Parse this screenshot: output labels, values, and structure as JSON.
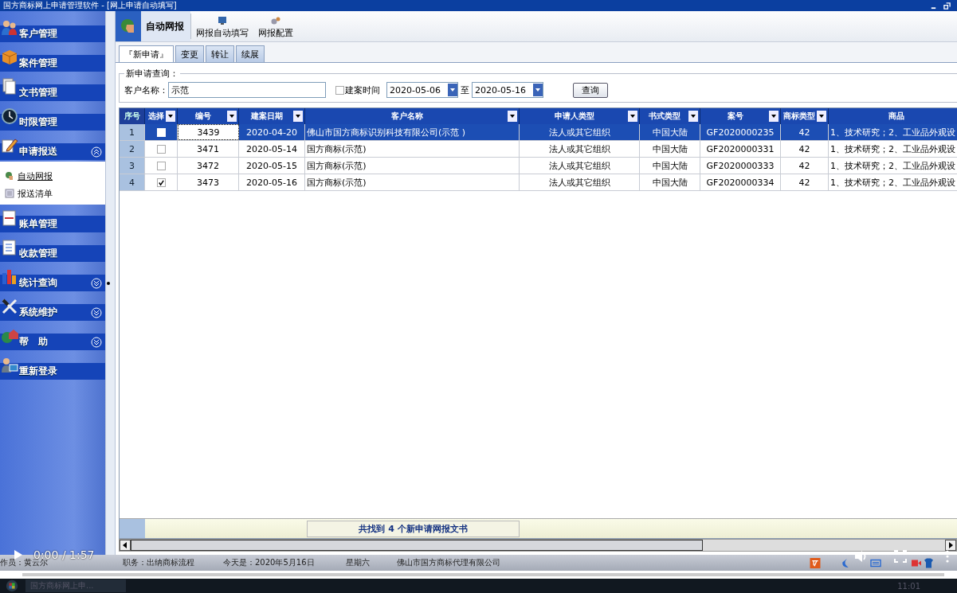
{
  "window": {
    "title": "国方商标网上申请管理软件 - [网上申请自动填写]"
  },
  "sidebar": {
    "items": [
      {
        "label": "客户管理"
      },
      {
        "label": "案件管理"
      },
      {
        "label": "文书管理"
      },
      {
        "label": "时限管理"
      },
      {
        "label": "申请报送",
        "expanded": true,
        "children": [
          {
            "label": "自动网报",
            "selected": true
          },
          {
            "label": "报送清单",
            "selected": false
          }
        ]
      },
      {
        "label": "账单管理"
      },
      {
        "label": "收款管理"
      },
      {
        "label": "统计查询",
        "expanded": false
      },
      {
        "label": "系统维护",
        "expanded": false
      },
      {
        "label": "帮　助",
        "expanded": false
      },
      {
        "label": "重新登录"
      }
    ]
  },
  "toolbar": {
    "items": [
      {
        "label": "自动网报",
        "kind": "large",
        "selected": true
      },
      {
        "label": "网报自动填写",
        "kind": "small",
        "selected": false
      },
      {
        "label": "网报配置",
        "kind": "small",
        "selected": false
      }
    ]
  },
  "tabs": [
    {
      "label": "『新申请』",
      "selected": true
    },
    {
      "label": "变更",
      "selected": false
    },
    {
      "label": "转让",
      "selected": false
    },
    {
      "label": "续展",
      "selected": false
    }
  ],
  "query": {
    "legend": "新申请查询：",
    "name_label": "客户名称：",
    "name_value": "示范",
    "date_filter": {
      "label": "建案时间",
      "checked": false
    },
    "date_from": "2020-05-06",
    "date_sep": "至",
    "date_to": "2020-05-16",
    "button": "查询"
  },
  "table": {
    "columns": [
      {
        "label": "序号",
        "kind": "index",
        "filter": false
      },
      {
        "label": "选择",
        "kind": "check",
        "filter": true
      },
      {
        "label": "编号",
        "kind": "center",
        "filter": true
      },
      {
        "label": "建案日期",
        "kind": "center",
        "filter": true
      },
      {
        "label": "客户名称",
        "kind": "left",
        "filter": true
      },
      {
        "label": "申请人类型",
        "kind": "center",
        "filter": true
      },
      {
        "label": "书式类型",
        "kind": "center",
        "filter": true
      },
      {
        "label": "案号",
        "kind": "center",
        "filter": true
      },
      {
        "label": "商标类型",
        "kind": "center",
        "filter": true
      },
      {
        "label": "商品",
        "kind": "left",
        "filter": false
      }
    ],
    "rows": [
      {
        "selected": true,
        "checked": false,
        "cells": [
          "1",
          "",
          "3439",
          "2020-04-20",
          "佛山市国方商标识别科技有限公司(示范 )",
          "法人或其它组织",
          "中国大陆",
          "GF2020000235",
          "42",
          "1、技术研究；2、工业品外观设"
        ]
      },
      {
        "selected": false,
        "checked": false,
        "cells": [
          "2",
          "",
          "3471",
          "2020-05-14",
          "国方商标(示范)",
          "法人或其它组织",
          "中国大陆",
          "GF2020000331",
          "42",
          "1、技术研究；2、工业品外观设"
        ]
      },
      {
        "selected": false,
        "checked": false,
        "cells": [
          "3",
          "",
          "3472",
          "2020-05-15",
          "国方商标(示范)",
          "法人或其它组织",
          "中国大陆",
          "GF2020000333",
          "42",
          "1、技术研究；2、工业品外观设"
        ]
      },
      {
        "selected": false,
        "checked": true,
        "cells": [
          "4",
          "",
          "3473",
          "2020-05-16",
          "国方商标(示范)",
          "法人或其它组织",
          "中国大陆",
          "GF2020000334",
          "42",
          "1、技术研究；2、工业品外观设"
        ]
      }
    ],
    "footer": "共找到 4 个新申请网报文书"
  },
  "status_bar": [
    "作员：黄云尔",
    "职务：出纳商标流程",
    "今天是：2020年5月16日",
    "星期六",
    "佛山市国方商标代理有限公司"
  ],
  "video_player": {
    "time": "0:00 / 1:57",
    "level": 0.01
  },
  "taskbar": {
    "task": "国方商标网上申...",
    "time": "11:01"
  }
}
